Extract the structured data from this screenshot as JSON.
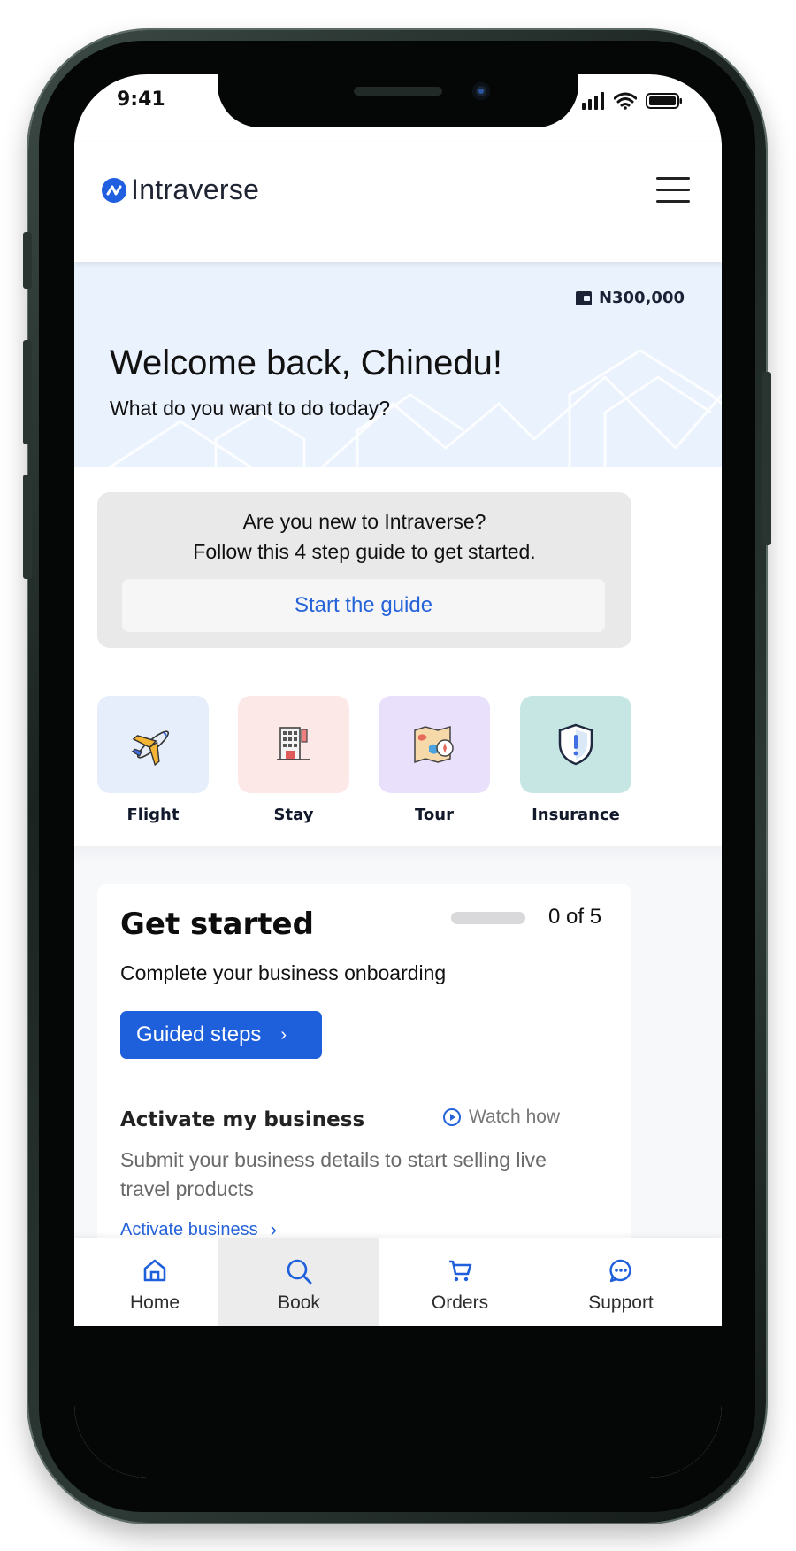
{
  "status_bar": {
    "time": "9:41"
  },
  "header": {
    "brand": "Intraverse",
    "menu_icon": "hamburger-menu-icon"
  },
  "welcome": {
    "wallet_amount": "N300,000",
    "title": "Welcome back, Chinedu!",
    "subtitle": "What do you want to do today?"
  },
  "guide": {
    "question": "Are you new to Intraverse?",
    "instruction": "Follow this 4 step guide to get started.",
    "button_label": "Start the guide"
  },
  "services": [
    {
      "label": "Flight",
      "icon": "airplane-icon",
      "color": "#e6eefb"
    },
    {
      "label": "Stay",
      "icon": "hotel-building-icon",
      "color": "#fde8e8"
    },
    {
      "label": "Tour",
      "icon": "map-compass-icon",
      "color": "#e9e0fb"
    },
    {
      "label": "Insurance",
      "icon": "shield-alert-icon",
      "color": "#c6e6e4"
    }
  ],
  "get_started": {
    "title": "Get started",
    "progress_done": 0,
    "progress_total": 5,
    "progress_text": "0 of 5",
    "subtitle": "Complete your business onboarding",
    "guided_button": "Guided steps",
    "activate_title": "Activate my business",
    "watch_label": "Watch how",
    "activate_desc": "Submit your business details to start selling live travel products",
    "activate_link": "Activate business"
  },
  "bottom_nav": [
    {
      "label": "Home",
      "icon": "home-icon",
      "active": false
    },
    {
      "label": "Book",
      "icon": "search-icon",
      "active": true
    },
    {
      "label": "Orders",
      "icon": "cart-icon",
      "active": false
    },
    {
      "label": "Support",
      "icon": "chat-bubble-icon",
      "active": false
    }
  ],
  "colors": {
    "accent": "#1e5fdc",
    "welcome_bg": "#eaf2fd"
  }
}
